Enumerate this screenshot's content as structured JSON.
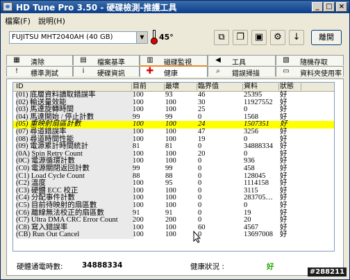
{
  "window": {
    "title": "HD Tune Pro 3.50 - 硬碟檢測-推護工具"
  },
  "menu": {
    "file": "檔案(F)",
    "help": "說明(H)"
  },
  "toolbar": {
    "drive": "FUJITSU MHT2040AH (40 GB)",
    "temperature": "45°",
    "exit_label": "離開",
    "icons": [
      "copy-icon",
      "copy-all-icon",
      "save-icon",
      "options-icon",
      "download-icon"
    ]
  },
  "tabs_row1": [
    {
      "label": "清除",
      "icon": "erase-icon"
    },
    {
      "label": "檔案基準",
      "icon": "file-benchmark-icon"
    },
    {
      "label": "磁碟監視",
      "icon": "disk-monitor-icon"
    },
    {
      "label": "工具",
      "icon": "tools-icon"
    },
    {
      "label": "隨機存取",
      "icon": "random-access-icon"
    }
  ],
  "tabs_row2": [
    {
      "label": "標準測試",
      "icon": "benchmark-icon"
    },
    {
      "label": "硬碟資訊",
      "icon": "info-icon"
    },
    {
      "label": "健康",
      "icon": "health-icon",
      "active": true
    },
    {
      "label": "錯誤掃描",
      "icon": "error-scan-icon"
    },
    {
      "label": "資料夾使用率",
      "icon": "folder-usage-icon"
    }
  ],
  "table": {
    "headers": [
      "ID",
      "目前",
      "最壞",
      "臨界值",
      "資料",
      "狀態"
    ],
    "rows": [
      [
        "(01) 底層資料讀取錯誤率",
        "100",
        "93",
        "46",
        "25395",
        "好"
      ],
      [
        "(02) 輸送量效能",
        "100",
        "100",
        "30",
        "11927552",
        "好"
      ],
      [
        "(03) 馬達旋轉時間",
        "100",
        "100",
        "25",
        "0",
        "好"
      ],
      [
        "(04) 馬達開始 / 停止計數",
        "99",
        "99",
        "0",
        "1568",
        "好"
      ],
      [
        "(05) 重映射扇區計數",
        "100",
        "100",
        "24",
        "1507351",
        "好"
      ],
      [
        "(07) 尋道錯誤率",
        "100",
        "100",
        "47",
        "3256",
        "好"
      ],
      [
        "(08) 尋道時間性能",
        "100",
        "100",
        "19",
        "0",
        "好"
      ],
      [
        "(09) 電源累計時間統計",
        "81",
        "81",
        "0",
        "34888334",
        "好"
      ],
      [
        "(0A) Spin Retry Count",
        "100",
        "100",
        "20",
        "0",
        "好"
      ],
      [
        "(0C) 電源循環計數",
        "100",
        "100",
        "0",
        "936",
        "好"
      ],
      [
        "(C0) 電源關閉返回計數",
        "99",
        "99",
        "0",
        "458",
        "好"
      ],
      [
        "(C1) Load Cycle Count",
        "88",
        "88",
        "0",
        "128045",
        "好"
      ],
      [
        "(C2) 溫度",
        "100",
        "95",
        "0",
        "1114158",
        "好"
      ],
      [
        "(C3) 硬體 ECC 校正",
        "100",
        "100",
        "0",
        "3115",
        "好"
      ],
      [
        "(C4) 分配事件計數",
        "100",
        "100",
        "0",
        "283705…",
        "好"
      ],
      [
        "(C5) 目前待映射的扇區數",
        "100",
        "100",
        "0",
        "0",
        "好"
      ],
      [
        "(C6) 離線無法校正的扇區數",
        "91",
        "91",
        "0",
        "19",
        "好"
      ],
      [
        "(C7) Ultra DMA CRC Error Count",
        "200",
        "200",
        "0",
        "20",
        "好"
      ],
      [
        "(C8) 寫入錯誤率",
        "100",
        "100",
        "60",
        "4567",
        "好"
      ],
      [
        "(CB) Run Out Cancel",
        "100",
        "100",
        "0",
        "13697008",
        "好"
      ]
    ],
    "highlighted_row": 4
  },
  "status": {
    "power_on_label": "硬體通電時數:",
    "power_on_value": "34888334",
    "health_label": "健康狀況 :",
    "health_value": "好"
  },
  "watermark": "#288211",
  "colors": {
    "highlight": "#ffff00",
    "health_good": "#22aa00",
    "active_tab": "#e68b2c"
  }
}
